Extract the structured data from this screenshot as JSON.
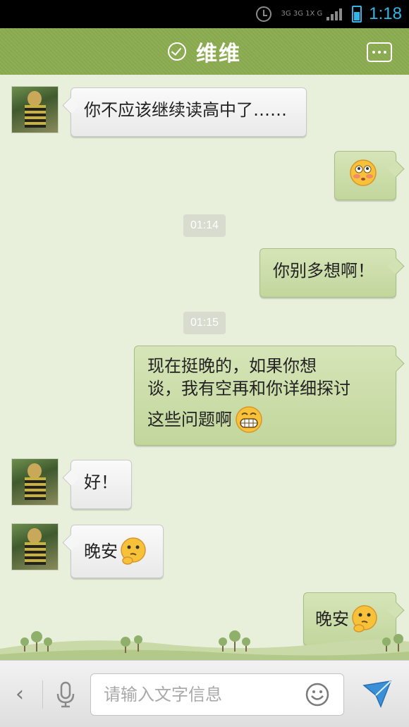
{
  "status_bar": {
    "network_top": "3G 3G 1X G",
    "time": "1:18"
  },
  "header": {
    "title": "维维"
  },
  "messages": [
    {
      "side": "left",
      "text": "你不应该继续读高中了……"
    },
    {
      "side": "right",
      "text": "",
      "emoji": "blushing-face-icon"
    },
    {
      "type": "timestamp",
      "text": "01:14"
    },
    {
      "side": "right",
      "text": "你别多想啊！"
    },
    {
      "type": "timestamp",
      "text": "01:15"
    },
    {
      "side": "right",
      "lines": [
        "现在挺晚的，如果你想",
        "谈，我有空再和你详细探讨",
        "这些问题啊"
      ],
      "emoji": "grinning-face-icon"
    },
    {
      "side": "left",
      "text": "好！"
    },
    {
      "side": "left",
      "text": "晚安",
      "emoji": "thinking-face-icon"
    },
    {
      "side": "right",
      "text": "晚安",
      "emoji": "thinking-face-icon"
    }
  ],
  "input": {
    "placeholder": "请输入文字信息"
  },
  "colors": {
    "header_green": "#8fae55",
    "right_bubble": "#c9dba6",
    "left_bubble": "#f2f2f2",
    "background": "#e8f0dc",
    "status_time": "#33b5e5"
  }
}
